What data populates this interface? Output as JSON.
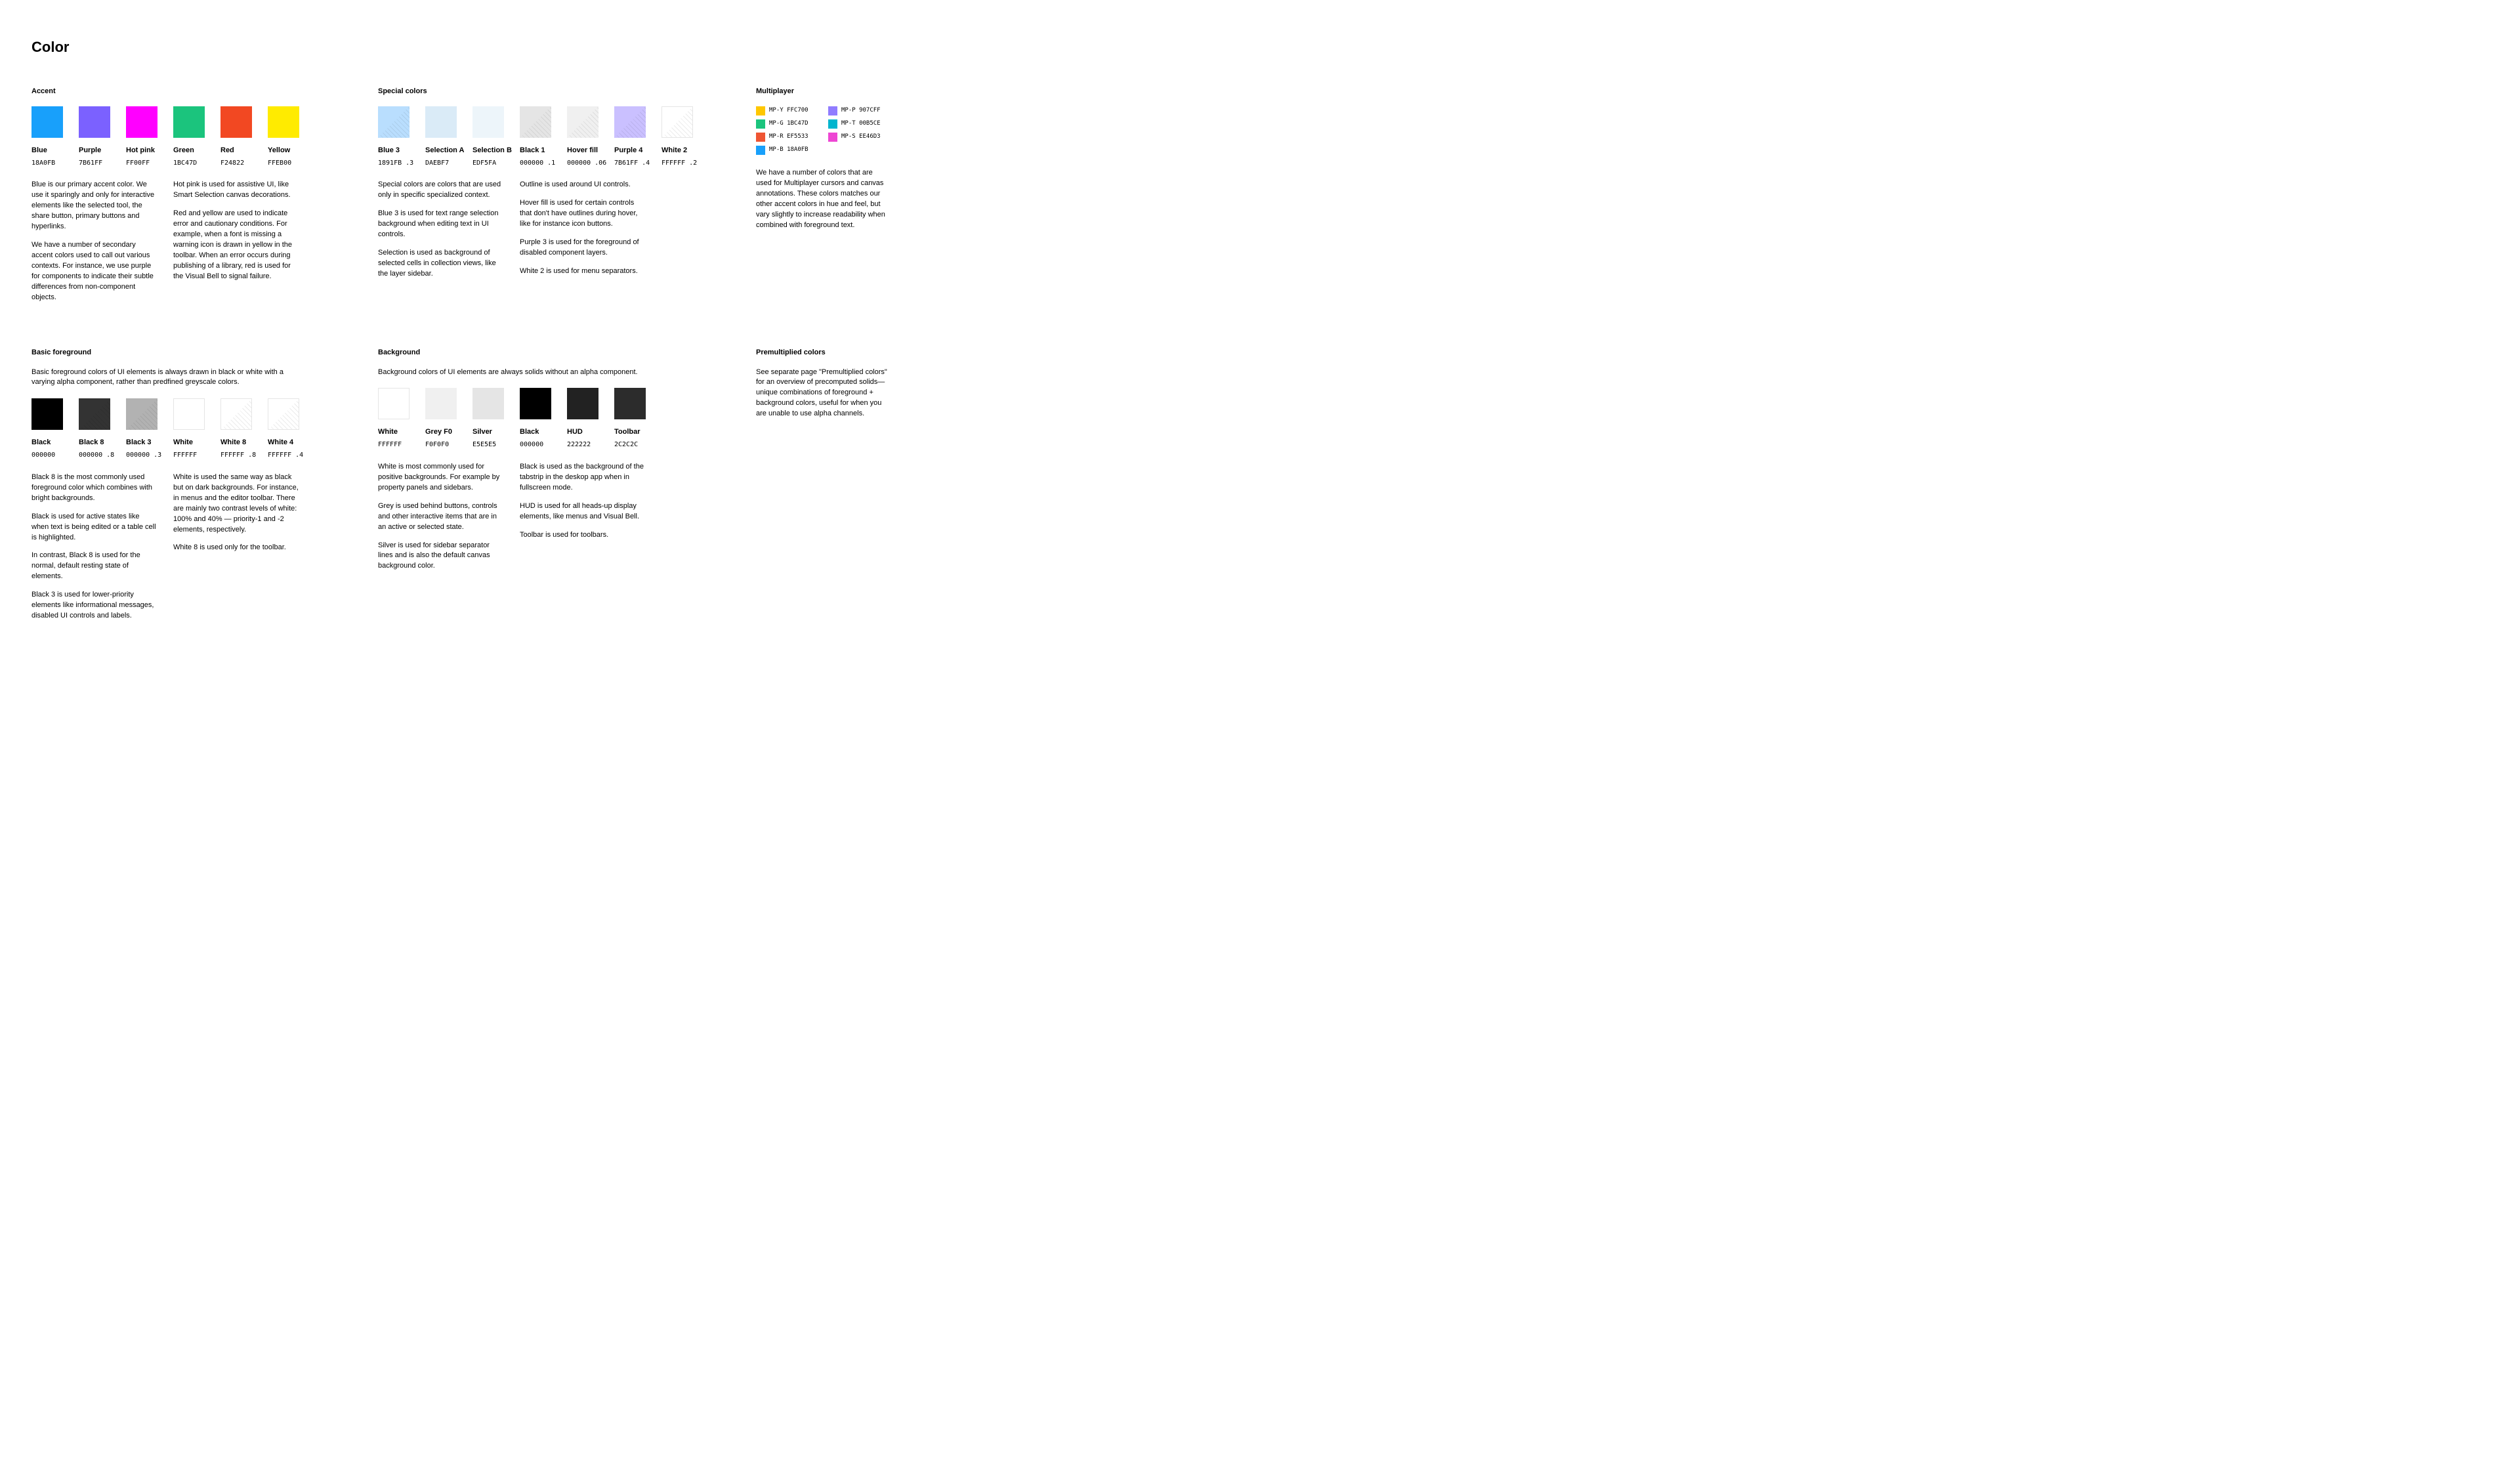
{
  "page_title": "Color",
  "accent": {
    "title": "Accent",
    "swatches": [
      {
        "name": "Blue",
        "code": "18A0FB",
        "hex": "#18A0FB"
      },
      {
        "name": "Purple",
        "code": "7B61FF",
        "hex": "#7B61FF"
      },
      {
        "name": "Hot pink",
        "code": "FF00FF",
        "hex": "#FF00FF"
      },
      {
        "name": "Green",
        "code": "1BC47D",
        "hex": "#1BC47D"
      },
      {
        "name": "Red",
        "code": "F24822",
        "hex": "#F24822"
      },
      {
        "name": "Yellow",
        "code": "FFEB00",
        "hex": "#FFEB00"
      }
    ],
    "col1": [
      "Blue is our primary accent color. We use it sparingly and only for interactive elements like the selected tool, the share button, primary buttons and hyperlinks.",
      "We have a number of secondary accent colors used to call out various contexts. For instance, we use purple for components to indicate their subtle differences from non-component objects."
    ],
    "col2": [
      "Hot pink is used for assistive UI, like Smart Selection canvas decorations.",
      "Red and yellow are used to indicate error and cautionary conditions. For example, when a font is missing a warning icon is drawn in yellow in the toolbar. When an error occurs during publishing of a library, red is used for the Visual Bell to signal failure."
    ]
  },
  "special": {
    "title": "Special colors",
    "swatches": [
      {
        "name": "Blue 3",
        "code": "1891FB .3",
        "hex": "rgba(24,145,251,0.30)",
        "hatch": true
      },
      {
        "name": "Selection A",
        "code": "DAEBF7",
        "hex": "#DAEBF7"
      },
      {
        "name": "Selection B",
        "code": "EDF5FA",
        "hex": "#EDF5FA"
      },
      {
        "name": "Black 1",
        "code": "000000 .1",
        "hex": "rgba(0,0,0,0.10)",
        "hatch": true
      },
      {
        "name": "Hover fill",
        "code": "000000 .06",
        "hex": "rgba(0,0,0,0.06)",
        "hatch": true
      },
      {
        "name": "Purple 4",
        "code": "7B61FF .4",
        "hex": "rgba(123,97,255,0.40)",
        "hatch": true
      },
      {
        "name": "White 2",
        "code": "FFFFFF .2",
        "hex": "rgba(255,255,255,0.20)",
        "hatch": true,
        "outlined": true
      }
    ],
    "col1": [
      "Special colors are colors that are used only in specific specialized context.",
      "Blue 3 is used for text range selection background when editing text in UI controls.",
      "Selection is used as background of selected cells in collection views, like the layer sidebar."
    ],
    "col2": [
      "Outline is used around UI controls.",
      "Hover fill is used for certain controls that don't have outlines during hover, like for instance icon buttons.",
      "Purple 3 is used for the foreground of disabled component layers.",
      "White 2 is used for menu separators."
    ]
  },
  "multiplayer": {
    "title": "Multiplayer",
    "chips": [
      {
        "label": "MP-Y FFC700",
        "hex": "#FFC700"
      },
      {
        "label": "MP-P 907CFF",
        "hex": "#907CFF"
      },
      {
        "label": "MP-G 1BC47D",
        "hex": "#1BC47D"
      },
      {
        "label": "MP-T 00B5CE",
        "hex": "#00B5CE"
      },
      {
        "label": "MP-R EF5533",
        "hex": "#EF5533"
      },
      {
        "label": "MP-S EE46D3",
        "hex": "#EE46D3"
      },
      {
        "label": "MP-B 18A0FB",
        "hex": "#18A0FB"
      }
    ],
    "desc": [
      "We have a number of colors that are used for Multiplayer cursors and canvas annotations. These colors matches our other accent colors in hue and feel, but vary slightly to increase readability when combined with foreground text."
    ]
  },
  "foreground": {
    "title": "Basic foreground",
    "intro": "Basic foreground colors of UI elements is always drawn in black or white with a varying alpha component, rather than predfined greyscale colors.",
    "swatches": [
      {
        "name": "Black",
        "code": "000000",
        "hex": "#000000"
      },
      {
        "name": "Black 8",
        "code": "000000 .8",
        "hex": "rgba(0,0,0,0.80)",
        "hatch": true
      },
      {
        "name": "Black 3",
        "code": "000000 .3",
        "hex": "rgba(0,0,0,0.30)",
        "hatch": true
      },
      {
        "name": "White",
        "code": "FFFFFF",
        "hex": "#FFFFFF",
        "outlined": true
      },
      {
        "name": "White 8",
        "code": "FFFFFF .8",
        "hex": "rgba(255,255,255,0.80)",
        "hatch": true,
        "outlined": true
      },
      {
        "name": "White 4",
        "code": "FFFFFF .4",
        "hex": "rgba(255,255,255,0.40)",
        "hatch": true,
        "outlined": true
      }
    ],
    "col1": [
      "Black 8 is the most commonly used foreground color which combines with bright backgrounds.",
      "Black is used for active states like when text is being edited or a table cell is highlighted.",
      "In contrast, Black 8 is used for the normal, default resting state of elements.",
      "Black 3 is used for lower-priority elements like informational messages, disabled UI controls and labels."
    ],
    "col2": [
      "White is used the same way as black but on dark backgrounds. For instance, in menus and the editor toolbar. There are mainly two contrast levels of white: 100% and 40% — priority-1 and -2 elements, respectively.",
      "White 8 is used only for the toolbar."
    ]
  },
  "background": {
    "title": "Background",
    "intro": "Background colors of UI elements are always solids without an alpha component.",
    "swatches": [
      {
        "name": "White",
        "code": "FFFFFF",
        "hex": "#FFFFFF",
        "outlined": true
      },
      {
        "name": "Grey F0",
        "code": "F0F0F0",
        "hex": "#F0F0F0"
      },
      {
        "name": "Silver",
        "code": "E5E5E5",
        "hex": "#E5E5E5"
      },
      {
        "name": "Black",
        "code": "000000",
        "hex": "#000000"
      },
      {
        "name": "HUD",
        "code": "222222",
        "hex": "#222222"
      },
      {
        "name": "Toolbar",
        "code": "2C2C2C",
        "hex": "#2C2C2C"
      }
    ],
    "col1": [
      "White is most commonly used for positive backgrounds. For example by property panels and sidebars.",
      "Grey is used behind buttons, controls and other interactive items that are in an active or selected state.",
      "Silver is used for sidebar separator lines and is also the default canvas background color."
    ],
    "col2": [
      "Black is used as the background of the tabstrip in the deskop app when in fullscreen mode.",
      "HUD is used for all heads-up display elements, like menus and Visual Bell.",
      "Toolbar is used for toolbars."
    ]
  },
  "premultiplied": {
    "title": "Premultiplied colors",
    "desc": [
      "See separate page \"Premultiplied colors\" for an overview of precomputed solids—unique combinations of foreground + background colors, useful for when you are unable to use alpha channels."
    ]
  }
}
